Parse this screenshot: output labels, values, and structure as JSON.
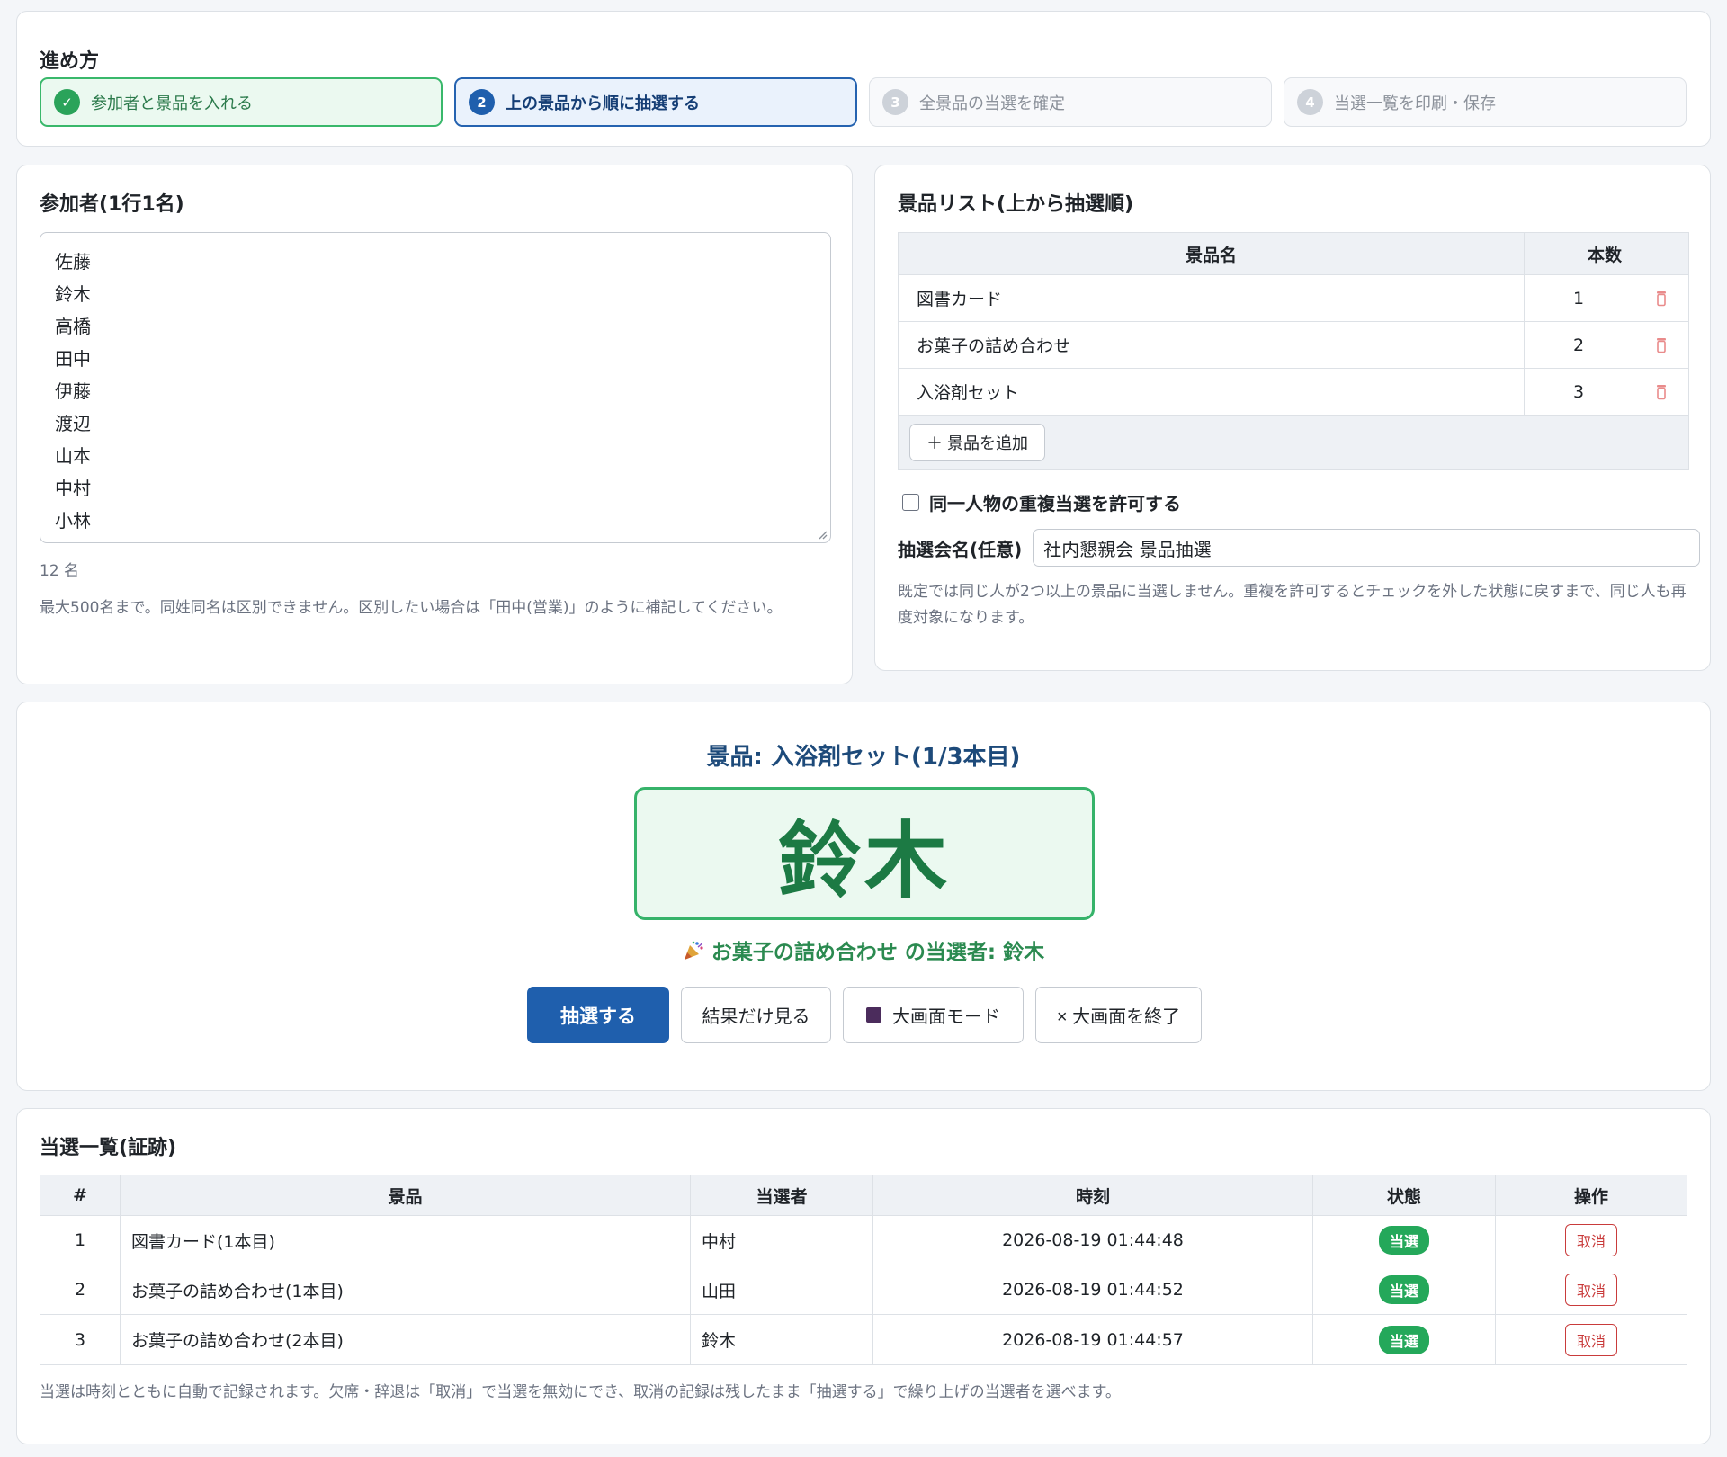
{
  "steps": {
    "title": "進め方",
    "items": [
      {
        "num": "✓",
        "label": "参加者と景品を入れる",
        "state": "done"
      },
      {
        "num": "2",
        "label": "上の景品から順に抽選する",
        "state": "active"
      },
      {
        "num": "3",
        "label": "全景品の当選を確定",
        "state": "pending"
      },
      {
        "num": "4",
        "label": "当選一覧を印刷・保存",
        "state": "pending"
      }
    ]
  },
  "participants": {
    "title": "参加者(1行1名)",
    "names": [
      "佐藤",
      "鈴木",
      "高橋",
      "田中",
      "伊藤",
      "渡辺",
      "山本",
      "中村",
      "小林"
    ],
    "count": "12 名",
    "hint": "最大500名まで。同姓同名は区別できません。区別したい場合は「田中(営業)」のように補記してください。"
  },
  "prizes": {
    "title": "景品リスト(上から抽選順)",
    "col_name": "景品名",
    "col_qty": "本数",
    "rows": [
      {
        "name": "図書カード",
        "qty": "1"
      },
      {
        "name": "お菓子の詰め合わせ",
        "qty": "2"
      },
      {
        "name": "入浴剤セット",
        "qty": "3"
      }
    ],
    "add_label": "＋ 景品を追加",
    "allow_duplicate_label": "同一人物の重複当選を許可する",
    "allow_duplicate_checked": false,
    "event_label": "抽選会名(任意)",
    "event_value": "社内懇親会 景品抽選",
    "hint": "既定では同じ人が2つ以上の景品に当選しません。重複を許可するとチェックを外した状態に戻すまで、同じ人も再度対象になります。"
  },
  "draw": {
    "title": "景品: 入浴剤セット(1/3本目)",
    "winner": "鈴木",
    "message": "お菓子の詰め合わせ の当選者: 鈴木",
    "btn_draw": "抽選する",
    "btn_result": "結果だけ見る",
    "btn_fullscreen": "大画面モード",
    "btn_exit": "× 大画面を終了"
  },
  "results": {
    "title": "当選一覧(証跡)",
    "headers": [
      "#",
      "景品",
      "当選者",
      "時刻",
      "状態",
      "操作"
    ],
    "rows": [
      {
        "no": "1",
        "prize": "図書カード(1本目)",
        "winner": "中村",
        "time": "2026-08-19 01:44:48",
        "status": "当選",
        "action": "取消"
      },
      {
        "no": "2",
        "prize": "お菓子の詰め合わせ(1本目)",
        "winner": "山田",
        "time": "2026-08-19 01:44:52",
        "status": "当選",
        "action": "取消"
      },
      {
        "no": "3",
        "prize": "お菓子の詰め合わせ(2本目)",
        "winner": "鈴木",
        "time": "2026-08-19 01:44:57",
        "status": "当選",
        "action": "取消"
      }
    ],
    "hint": "当選は時刻とともに自動で記録されます。欠席・辞退は「取消」で当選を無効にでき、取消の記録は残したまま「抽選する」で繰り上げの当選者を選べます。"
  },
  "colors": {
    "accent": "#1f5fad",
    "success": "#24a85a",
    "danger": "#c93b3b"
  }
}
